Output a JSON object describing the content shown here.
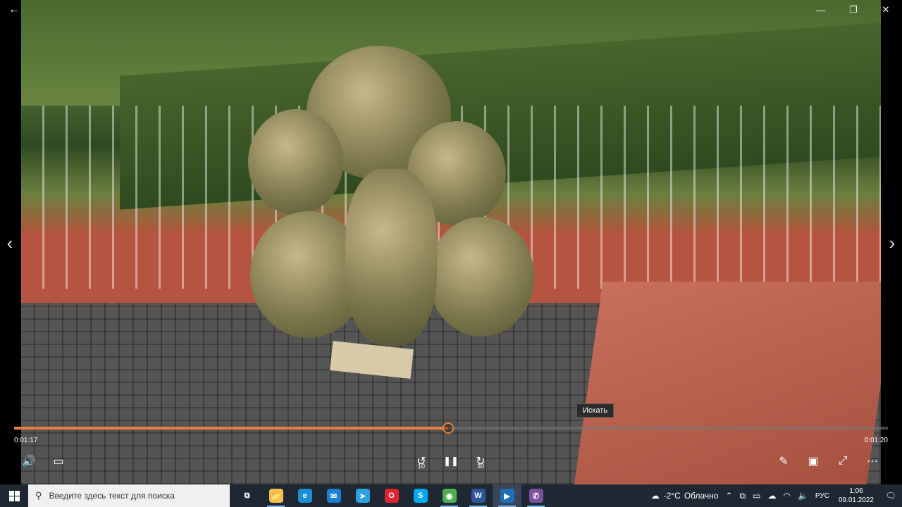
{
  "window": {
    "back_icon": "arrow-left-icon",
    "minimize": "—",
    "maximize": "❐",
    "close": "✕"
  },
  "navigation": {
    "prev": "‹",
    "next": "›"
  },
  "tooltip": {
    "text": "Искать"
  },
  "player": {
    "progress": 0.497,
    "time_current": "0:01:17",
    "time_total": "0:01:20",
    "volume_icon": "🔊",
    "subtitles_icon": "▭",
    "rewind_label": "10",
    "pause_icon": "❚❚",
    "forward_label": "30",
    "edit_icon": "✎",
    "miniview_icon": "▣",
    "fullscreen_icon": "⤢",
    "more_icon": "⋯",
    "accent": "#e6803a"
  },
  "taskbar": {
    "search_placeholder": "Введите здесь текст для поиска",
    "apps": [
      {
        "name": "task-view",
        "glyph": "⧉",
        "color": "transparent"
      },
      {
        "name": "file-explorer",
        "glyph": "📁",
        "color": "#f2c14e"
      },
      {
        "name": "edge",
        "glyph": "e",
        "color": "#1a8fd6"
      },
      {
        "name": "mail",
        "glyph": "✉",
        "color": "#1c7ed6"
      },
      {
        "name": "telegram",
        "glyph": "➤",
        "color": "#2aa3e0"
      },
      {
        "name": "opera",
        "glyph": "O",
        "color": "#e0242f"
      },
      {
        "name": "skype",
        "glyph": "S",
        "color": "#00a9f0"
      },
      {
        "name": "chrome",
        "glyph": "◉",
        "color": "#4caf50"
      },
      {
        "name": "word",
        "glyph": "W",
        "color": "#2b5797"
      },
      {
        "name": "movies-tv",
        "glyph": "▶",
        "color": "#1e6fb8"
      },
      {
        "name": "viber",
        "glyph": "✆",
        "color": "#7b519d"
      }
    ],
    "weather_temp": "-2°C",
    "weather_text": "Облачно",
    "language": "РУС",
    "time": "1:06",
    "date": "09.01.2022"
  }
}
